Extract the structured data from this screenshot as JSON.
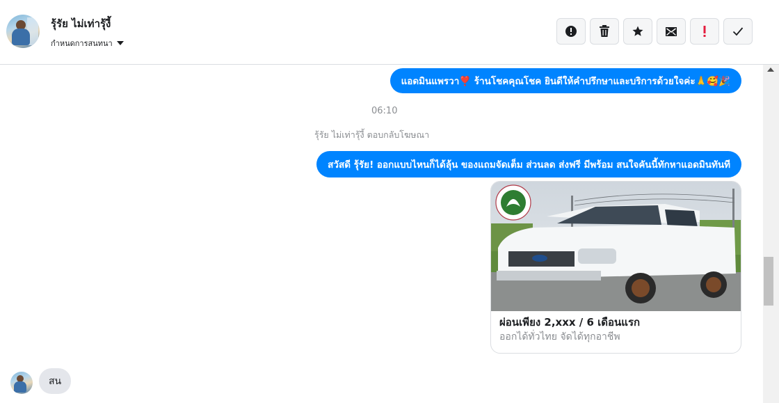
{
  "header": {
    "contact_name": "รุ้รัย ไม่เท่ารุ้งี้",
    "assign_label": "กำหนดการสนทนา",
    "actions": [
      {
        "icon": "alert-circle-icon",
        "name": "mark-spam-button"
      },
      {
        "icon": "trash-icon",
        "name": "delete-button"
      },
      {
        "icon": "star-icon",
        "name": "star-button"
      },
      {
        "icon": "mark-unread-icon",
        "name": "mark-unread-button"
      },
      {
        "icon": "exclamation-icon",
        "name": "follow-up-button"
      },
      {
        "icon": "check-icon",
        "name": "mark-done-button"
      }
    ]
  },
  "messages": {
    "outgoing_1": "แอดมินแพรวา❣️ ร้านโชคคุณโชค ยินดีให้คำปรึกษาและบริการด้วยใจค่ะ🙏🥰🎉",
    "timestamp": "06:10",
    "system_note": "รุ้รัย ไม่เท่ารุ้งี้ ตอบกลับโฆษณา",
    "outgoing_2": "สวัสดี รุ้รัย! ออกแบบไหนก็ได้ลุ้น ของแถมจัดเต็ม ส่วนลด ส่งฟรี มีพร้อม สนใจคันนี้ทักหาแอดมินทันที",
    "ad_card": {
      "title": "ผ่อนเพียง 2,xxx / 6 เดือนแรก",
      "subtitle": "ออกได้ทั่วไทย จัดได้ทุกอาชีพ"
    },
    "incoming_1": "สน"
  },
  "colors": {
    "outgoing_bubble": "#0084ff",
    "incoming_bubble": "#e4e6eb",
    "follow_up_red": "#e41e3f"
  }
}
